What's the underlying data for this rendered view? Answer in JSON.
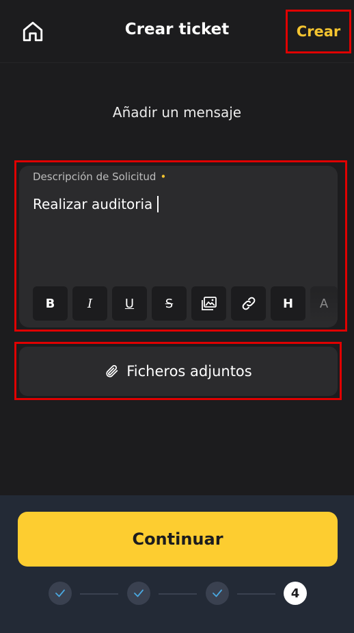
{
  "header": {
    "title": "Crear ticket",
    "create_label": "Crear",
    "home_icon": "home-icon"
  },
  "section_title": "Añadir un mensaje",
  "description": {
    "label": "Descripción de Solicitud",
    "required_marker": "•",
    "value": "Realizar auditoria"
  },
  "toolbar": {
    "buttons": [
      {
        "name": "bold",
        "glyph": "B"
      },
      {
        "name": "italic",
        "glyph": "I"
      },
      {
        "name": "underline",
        "glyph": "U"
      },
      {
        "name": "strikethrough",
        "glyph": "S"
      },
      {
        "name": "image",
        "icon": "image-icon"
      },
      {
        "name": "link",
        "icon": "link-icon"
      },
      {
        "name": "heading",
        "glyph": "H"
      },
      {
        "name": "text-color",
        "glyph": "A"
      }
    ]
  },
  "attachments": {
    "label": "Ficheros adjuntos",
    "icon": "paperclip-icon"
  },
  "footer": {
    "continue_label": "Continuar",
    "steps": [
      {
        "state": "done"
      },
      {
        "state": "done"
      },
      {
        "state": "done"
      },
      {
        "state": "current",
        "label": "4"
      }
    ]
  },
  "colors": {
    "accent": "#fdcd30",
    "header_action": "#f4c430",
    "highlight_outline": "#e00000",
    "step_check": "#4aa8e0"
  }
}
